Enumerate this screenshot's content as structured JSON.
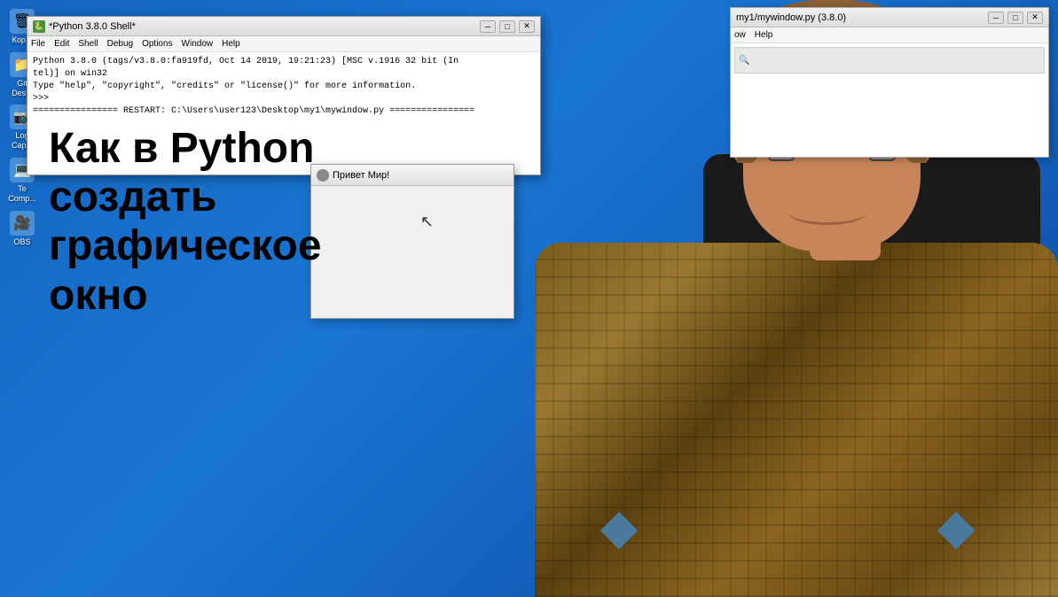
{
  "desktop": {
    "background_color": "#1565c0",
    "icons": [
      {
        "id": "icon-1",
        "label": "Кор...",
        "emoji": "🗑"
      },
      {
        "id": "icon-2",
        "label": "Git\nDes...",
        "emoji": "📁"
      },
      {
        "id": "icon-3",
        "label": "Log\nCap...",
        "emoji": "📷"
      },
      {
        "id": "icon-4",
        "label": "Te\nComp...",
        "emoji": "💻"
      },
      {
        "id": "icon-5",
        "label": "OBS",
        "emoji": "🎥"
      }
    ]
  },
  "overlay": {
    "main_title_line1": "Как в Python",
    "main_title_line2": "создать",
    "main_title_line3": "графическое",
    "main_title_line4": "окно"
  },
  "python_shell": {
    "title": "*Python 3.8.0 Shell*",
    "menu_items": [
      "File",
      "Edit",
      "Shell",
      "Debug",
      "Options",
      "Window",
      "Help"
    ],
    "content_line1": "Python 3.8.0 (tags/v3.8.0:fa919fd, Oct 14 2019, 19:21:23) [MSC v.1916 32 bit (In",
    "content_line2": "tel)] on win32",
    "content_line3": "Type \"help\", \"copyright\", \"credits\" or \"license()\" for more information.",
    "content_line4": ">>> ",
    "content_line5": "================ RESTART: C:\\Users\\user123\\Desktop\\my1\\mywindow.py ================"
  },
  "editor_window": {
    "title": "my1/mywindow.py (3.8.0)",
    "menu_items": [
      "ow",
      "Help"
    ]
  },
  "tkinter_window": {
    "title": "Привет Мир!",
    "icon": "🪶"
  },
  "cursor": {
    "visible": true
  }
}
